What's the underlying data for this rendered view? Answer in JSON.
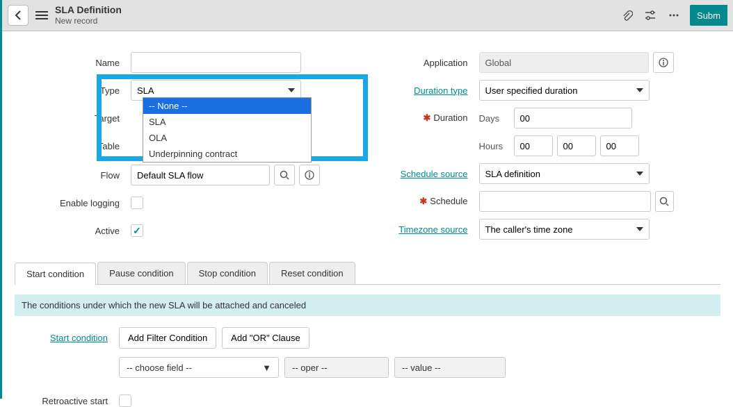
{
  "header": {
    "title": "SLA Definition",
    "subtitle": "New record",
    "submit_label": "Subm"
  },
  "left_form": {
    "name_label": "Name",
    "type_label": "Type",
    "type_value": "SLA",
    "type_options": {
      "none": "-- None --",
      "sla": "SLA",
      "ola": "OLA",
      "upc": "Underpinning contract"
    },
    "target_label": "Target",
    "table_label": "Table",
    "flow_label": "Flow",
    "flow_value": "Default SLA flow",
    "enable_logging_label": "Enable logging",
    "active_label": "Active"
  },
  "right_form": {
    "application_label": "Application",
    "application_value": "Global",
    "duration_type_label": "Duration type",
    "duration_type_value": "User specified duration",
    "duration_label": "Duration",
    "days_label": "Days",
    "days_value": "00",
    "hours_label": "Hours",
    "hh": "00",
    "mm": "00",
    "ss": "00",
    "schedule_source_label": "Schedule source",
    "schedule_source_value": "SLA definition",
    "schedule_label": "Schedule",
    "timezone_source_label": "Timezone source",
    "timezone_source_value": "The caller's time zone"
  },
  "tabs": {
    "start": "Start condition",
    "pause": "Pause condition",
    "stop": "Stop condition",
    "reset": "Reset condition",
    "info": "The conditions under which the new SLA will be attached and canceled",
    "start_condition_label": "Start condition",
    "add_filter": "Add Filter Condition",
    "add_or": "Add \"OR\" Clause",
    "choose_field": "-- choose field --",
    "oper": "-- oper --",
    "value": "-- value --",
    "retroactive_label": "Retroactive start"
  }
}
